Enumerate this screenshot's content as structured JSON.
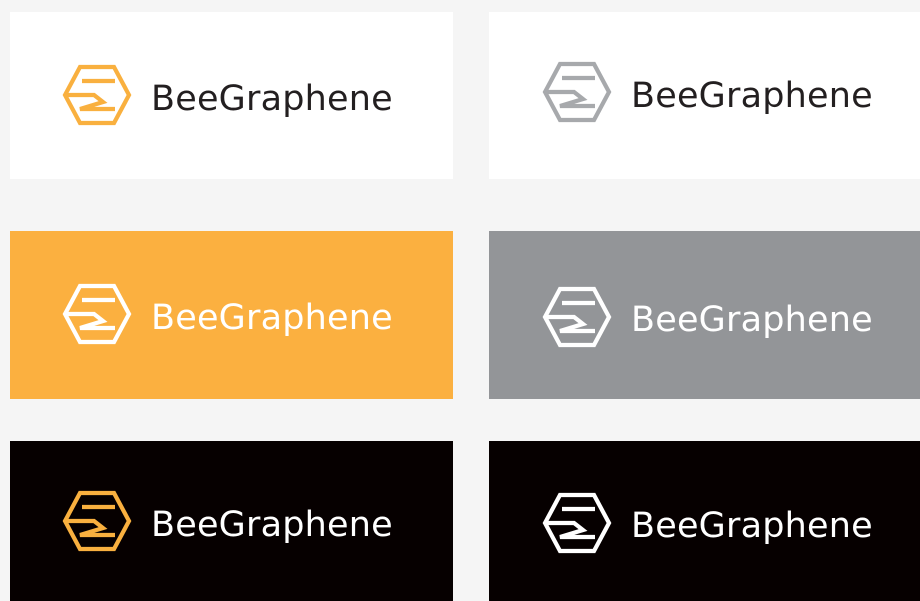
{
  "brand_name": "BeeGraphene",
  "panels": [
    {
      "background": "#ffffff",
      "mark_color": "#f9b03f",
      "text_color": "#231f20"
    },
    {
      "background": "#ffffff",
      "mark_color": "#a7a9ac",
      "text_color": "#231f20"
    },
    {
      "background": "#fbb040",
      "mark_color": "#ffffff",
      "text_color": "#ffffff"
    },
    {
      "background": "#939598",
      "mark_color": "#ffffff",
      "text_color": "#ffffff"
    },
    {
      "background": "#060000",
      "mark_color": "#f9b03f",
      "text_color": "#ffffff"
    },
    {
      "background": "#060000",
      "mark_color": "#ffffff",
      "text_color": "#ffffff"
    }
  ],
  "icons": {
    "logo_mark": "hexagon-logo-icon"
  }
}
